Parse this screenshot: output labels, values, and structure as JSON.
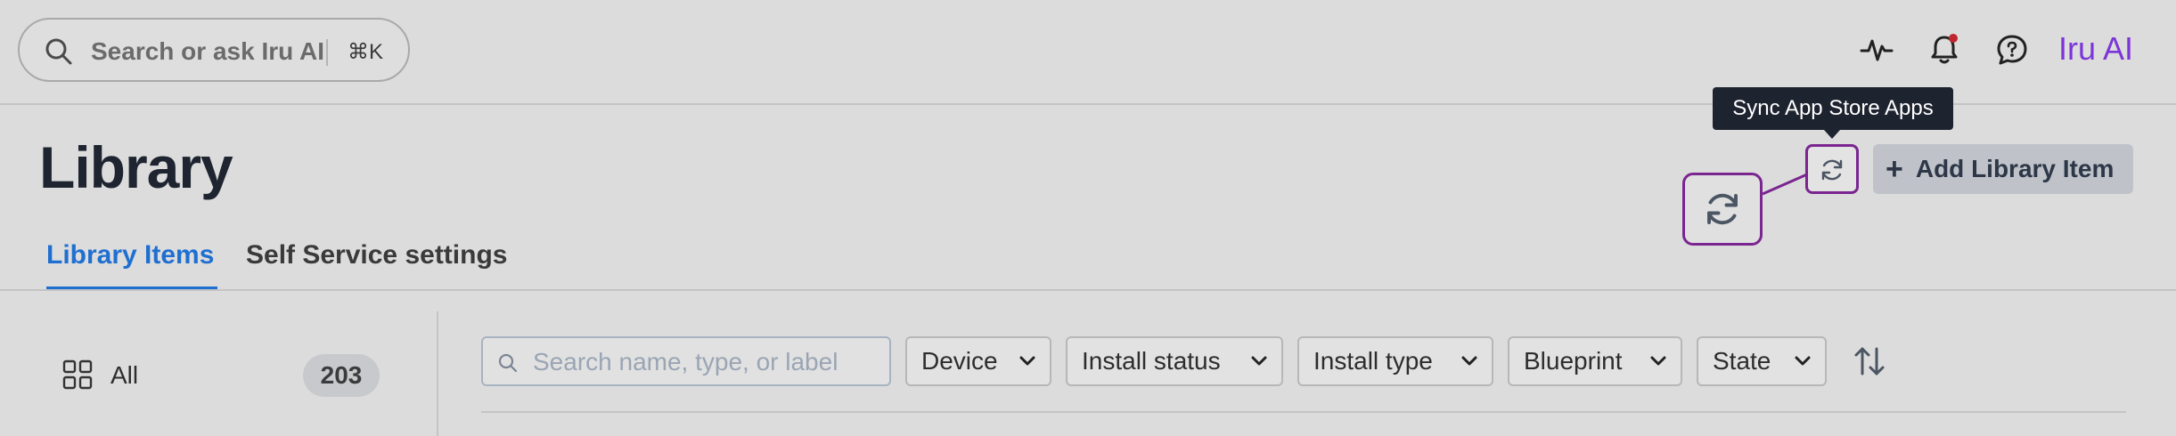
{
  "topbar": {
    "search_placeholder": "Search or ask Iru AI",
    "search_shortcut": "⌘K",
    "icons": [
      "activity-icon",
      "bell-icon",
      "chat-icon"
    ],
    "notification_dot_color": "#c0262d",
    "ai_link": "Iru AI",
    "ai_link_color": "#7b35d8"
  },
  "page": {
    "title": "Library",
    "tabs": [
      {
        "label": "Library Items",
        "active": true
      },
      {
        "label": "Self Service settings",
        "active": false
      }
    ]
  },
  "actions": {
    "sync_tooltip": "Sync App Store Apps",
    "add_label": "Add Library Item",
    "highlight_color": "#7a2590"
  },
  "sidebar": {
    "items": [
      {
        "label": "All",
        "count": "203"
      }
    ]
  },
  "filters": {
    "search_placeholder": "Search name, type, or label",
    "dropdowns": [
      "Device",
      "Install status",
      "Install type",
      "Blueprint",
      "State"
    ]
  }
}
